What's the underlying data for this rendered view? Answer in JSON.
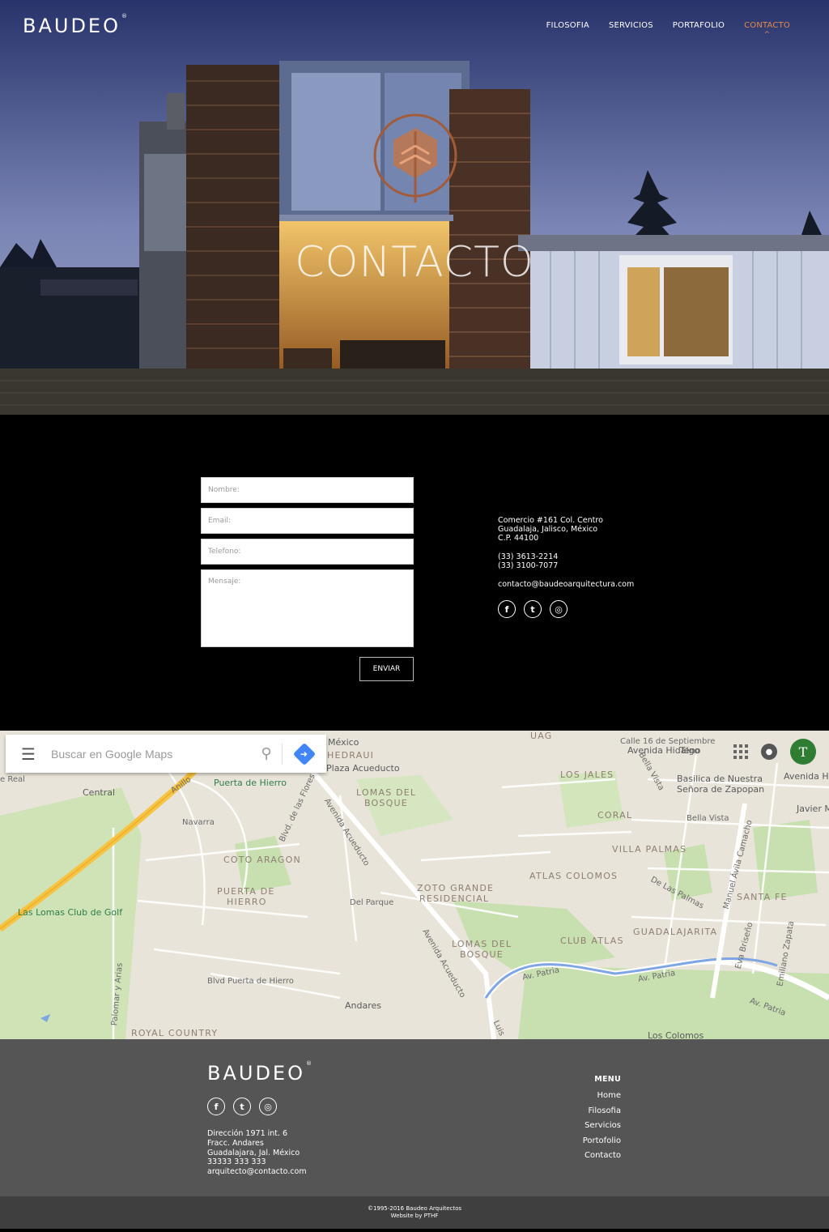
{
  "header": {
    "logo": "BAUDEO",
    "logo_mark": "®",
    "nav": [
      {
        "label": "FILOSOFIA",
        "active": false
      },
      {
        "label": "SERVICIOS",
        "active": false
      },
      {
        "label": "PORTAFOLIO",
        "active": false
      },
      {
        "label": "CONTACTO",
        "active": true
      }
    ],
    "active_caret": "^"
  },
  "hero": {
    "title": "CONTACTO"
  },
  "form": {
    "name_placeholder": "Nombre:",
    "email_placeholder": "Email:",
    "phone_placeholder": "Telefono:",
    "message_placeholder": "Mensaje:",
    "send_label": "ENVIAR"
  },
  "contact_info": {
    "address_line1": "Comercio #161 Col. Centro",
    "address_line2": "Guadalaja, Jalisco, México",
    "address_line3": "C.P. 44100",
    "phone1": "(33) 3613-2214",
    "phone2": "(33) 3100-7077",
    "email": "contacto@baudeoarquitectura.com",
    "socials": [
      {
        "icon": "facebook-icon",
        "glyph": "f"
      },
      {
        "icon": "twitter-icon",
        "glyph": "t"
      },
      {
        "icon": "instagram-icon",
        "glyph": "◎"
      }
    ]
  },
  "map": {
    "search_placeholder": "Buscar en Google Maps",
    "avatar_letter": "T",
    "labels": {
      "mexico": "México",
      "plaza": "Plaza Acueducto",
      "hedraui": "HEDRAUI",
      "uag": "UAG",
      "sep16": "Calle 16 de Septiembre",
      "hidalgo": "Avenida Hidalgo",
      "teno": "Teno",
      "los_jales": "LOS JALES",
      "bella_vista1": "Bella Vista",
      "basilica1": "Basilica de Nuestra",
      "basilica2": "Señora de Zapopan",
      "av_h": "Avenida H",
      "javier": "Javier M",
      "real": "e Real",
      "central": "Central",
      "anillo": "Anillo",
      "puerta_hierro_poi": "Puerta de Hierro",
      "lomas_bosque1": "LOMAS DEL",
      "lomas_bosque2": "BOSQUE",
      "blvd_flores": "Blvd. de las Flores",
      "av_acueducto1": "Avenida Acueducto",
      "navarra": "Navarra",
      "coral": "CORAL",
      "bella_vista2": "Bella Vista",
      "coto_aragon": "COTO ARAGON",
      "villa_palmas": "VILLA PALMAS",
      "atlas_colomos": "ATLAS COLOMOS",
      "manuel_avila": "Manuel Ávila Camacho",
      "de_las_palmas": "De Las Palmas",
      "puerta_hierro1": "PUERTA DE",
      "puerta_hierro2": "HIERRO",
      "del_parque": "Del Parque",
      "coto_grande1": "ZOTO GRANDE",
      "coto_grande2": "RESIDENCIAL",
      "santa_fe": "SANTA FE",
      "lomas_golf": "Las Lomas Club de Golf",
      "guadalajarita": "GUADALAJARITA",
      "lomas_bosque3": "LOMAS DEL",
      "lomas_bosque4": "BOSQUE",
      "club_atlas": "CLUB ATLAS",
      "av_acueducto2": "Avenida Acueducto",
      "eva_briseno": "Eva Briseño",
      "emiliano": "Emiliano Zapata",
      "palomar": "Palomar y Arias",
      "blvd_puerta": "Blvd Puerta de Hierro",
      "av_patria1": "Av. Patria",
      "av_patria2": "Av. Patria",
      "av_patria3": "Av. Patria",
      "andares": "Andares",
      "royal": "ROYAL COUNTRY",
      "los_colomos": "Los Colomos",
      "luis": "Luis"
    }
  },
  "footer": {
    "logo": "BAUDEO",
    "logo_mark": "®",
    "address_line1": "Dirección 1971 int. 6",
    "address_line2": "Fracc. Andares",
    "address_line3": "Guadalajara, Jal. México",
    "phone": "33333 333 333",
    "email": "arquitecto@contacto.com",
    "menu_title": "MENU",
    "menu": [
      "Home",
      "Filosofia",
      "Servicios",
      "Portofolio",
      "Contacto"
    ],
    "copyright": "©1995-2016 Baudeo Arquitectos",
    "credit": "Website by PTHF"
  },
  "colors": {
    "accent": "#e48a4e",
    "form_bg": "#000000",
    "footer_bg": "#555555",
    "copyright_bg": "#3f3f3f",
    "map_land": "#e8e4d9",
    "map_park": "#c8dfb0",
    "map_highway": "#f6c342",
    "map_river": "#7fa6e4",
    "avatar_green": "#2e7d32"
  }
}
